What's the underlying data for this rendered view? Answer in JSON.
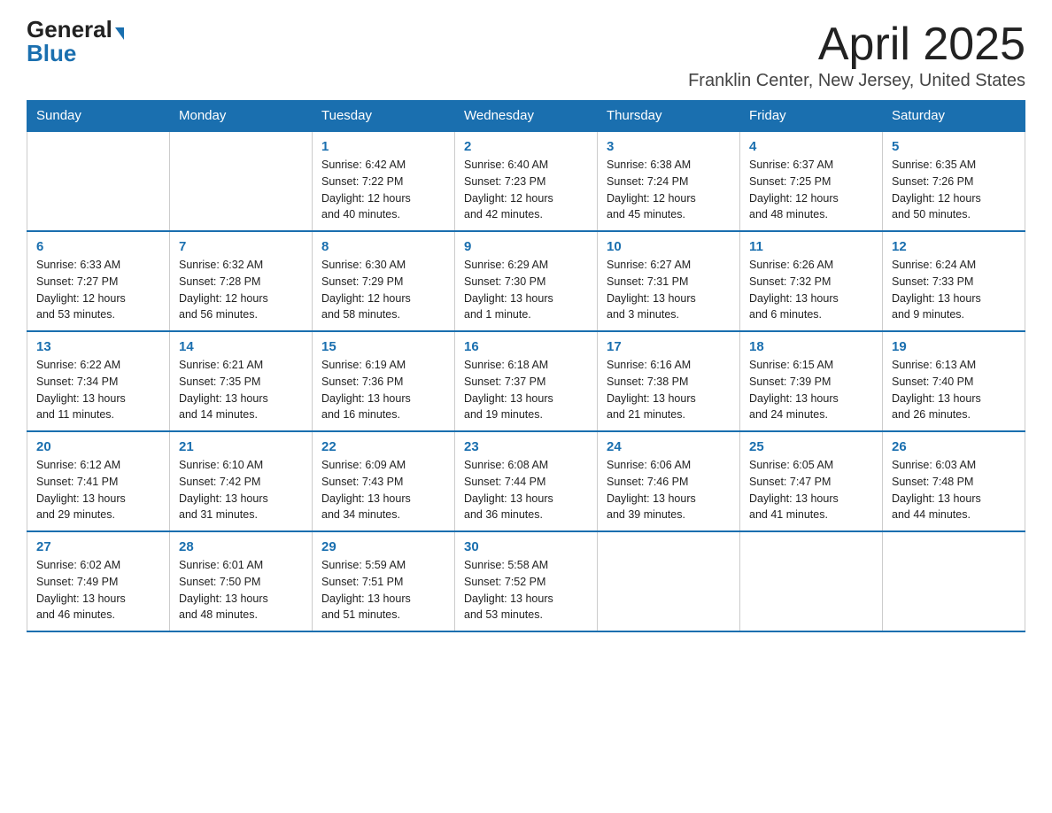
{
  "logo": {
    "general": "General",
    "blue": "Blue"
  },
  "title": "April 2025",
  "location": "Franklin Center, New Jersey, United States",
  "days_of_week": [
    "Sunday",
    "Monday",
    "Tuesday",
    "Wednesday",
    "Thursday",
    "Friday",
    "Saturday"
  ],
  "weeks": [
    [
      {
        "day": "",
        "info": ""
      },
      {
        "day": "",
        "info": ""
      },
      {
        "day": "1",
        "info": "Sunrise: 6:42 AM\nSunset: 7:22 PM\nDaylight: 12 hours\nand 40 minutes."
      },
      {
        "day": "2",
        "info": "Sunrise: 6:40 AM\nSunset: 7:23 PM\nDaylight: 12 hours\nand 42 minutes."
      },
      {
        "day": "3",
        "info": "Sunrise: 6:38 AM\nSunset: 7:24 PM\nDaylight: 12 hours\nand 45 minutes."
      },
      {
        "day": "4",
        "info": "Sunrise: 6:37 AM\nSunset: 7:25 PM\nDaylight: 12 hours\nand 48 minutes."
      },
      {
        "day": "5",
        "info": "Sunrise: 6:35 AM\nSunset: 7:26 PM\nDaylight: 12 hours\nand 50 minutes."
      }
    ],
    [
      {
        "day": "6",
        "info": "Sunrise: 6:33 AM\nSunset: 7:27 PM\nDaylight: 12 hours\nand 53 minutes."
      },
      {
        "day": "7",
        "info": "Sunrise: 6:32 AM\nSunset: 7:28 PM\nDaylight: 12 hours\nand 56 minutes."
      },
      {
        "day": "8",
        "info": "Sunrise: 6:30 AM\nSunset: 7:29 PM\nDaylight: 12 hours\nand 58 minutes."
      },
      {
        "day": "9",
        "info": "Sunrise: 6:29 AM\nSunset: 7:30 PM\nDaylight: 13 hours\nand 1 minute."
      },
      {
        "day": "10",
        "info": "Sunrise: 6:27 AM\nSunset: 7:31 PM\nDaylight: 13 hours\nand 3 minutes."
      },
      {
        "day": "11",
        "info": "Sunrise: 6:26 AM\nSunset: 7:32 PM\nDaylight: 13 hours\nand 6 minutes."
      },
      {
        "day": "12",
        "info": "Sunrise: 6:24 AM\nSunset: 7:33 PM\nDaylight: 13 hours\nand 9 minutes."
      }
    ],
    [
      {
        "day": "13",
        "info": "Sunrise: 6:22 AM\nSunset: 7:34 PM\nDaylight: 13 hours\nand 11 minutes."
      },
      {
        "day": "14",
        "info": "Sunrise: 6:21 AM\nSunset: 7:35 PM\nDaylight: 13 hours\nand 14 minutes."
      },
      {
        "day": "15",
        "info": "Sunrise: 6:19 AM\nSunset: 7:36 PM\nDaylight: 13 hours\nand 16 minutes."
      },
      {
        "day": "16",
        "info": "Sunrise: 6:18 AM\nSunset: 7:37 PM\nDaylight: 13 hours\nand 19 minutes."
      },
      {
        "day": "17",
        "info": "Sunrise: 6:16 AM\nSunset: 7:38 PM\nDaylight: 13 hours\nand 21 minutes."
      },
      {
        "day": "18",
        "info": "Sunrise: 6:15 AM\nSunset: 7:39 PM\nDaylight: 13 hours\nand 24 minutes."
      },
      {
        "day": "19",
        "info": "Sunrise: 6:13 AM\nSunset: 7:40 PM\nDaylight: 13 hours\nand 26 minutes."
      }
    ],
    [
      {
        "day": "20",
        "info": "Sunrise: 6:12 AM\nSunset: 7:41 PM\nDaylight: 13 hours\nand 29 minutes."
      },
      {
        "day": "21",
        "info": "Sunrise: 6:10 AM\nSunset: 7:42 PM\nDaylight: 13 hours\nand 31 minutes."
      },
      {
        "day": "22",
        "info": "Sunrise: 6:09 AM\nSunset: 7:43 PM\nDaylight: 13 hours\nand 34 minutes."
      },
      {
        "day": "23",
        "info": "Sunrise: 6:08 AM\nSunset: 7:44 PM\nDaylight: 13 hours\nand 36 minutes."
      },
      {
        "day": "24",
        "info": "Sunrise: 6:06 AM\nSunset: 7:46 PM\nDaylight: 13 hours\nand 39 minutes."
      },
      {
        "day": "25",
        "info": "Sunrise: 6:05 AM\nSunset: 7:47 PM\nDaylight: 13 hours\nand 41 minutes."
      },
      {
        "day": "26",
        "info": "Sunrise: 6:03 AM\nSunset: 7:48 PM\nDaylight: 13 hours\nand 44 minutes."
      }
    ],
    [
      {
        "day": "27",
        "info": "Sunrise: 6:02 AM\nSunset: 7:49 PM\nDaylight: 13 hours\nand 46 minutes."
      },
      {
        "day": "28",
        "info": "Sunrise: 6:01 AM\nSunset: 7:50 PM\nDaylight: 13 hours\nand 48 minutes."
      },
      {
        "day": "29",
        "info": "Sunrise: 5:59 AM\nSunset: 7:51 PM\nDaylight: 13 hours\nand 51 minutes."
      },
      {
        "day": "30",
        "info": "Sunrise: 5:58 AM\nSunset: 7:52 PM\nDaylight: 13 hours\nand 53 minutes."
      },
      {
        "day": "",
        "info": ""
      },
      {
        "day": "",
        "info": ""
      },
      {
        "day": "",
        "info": ""
      }
    ]
  ]
}
